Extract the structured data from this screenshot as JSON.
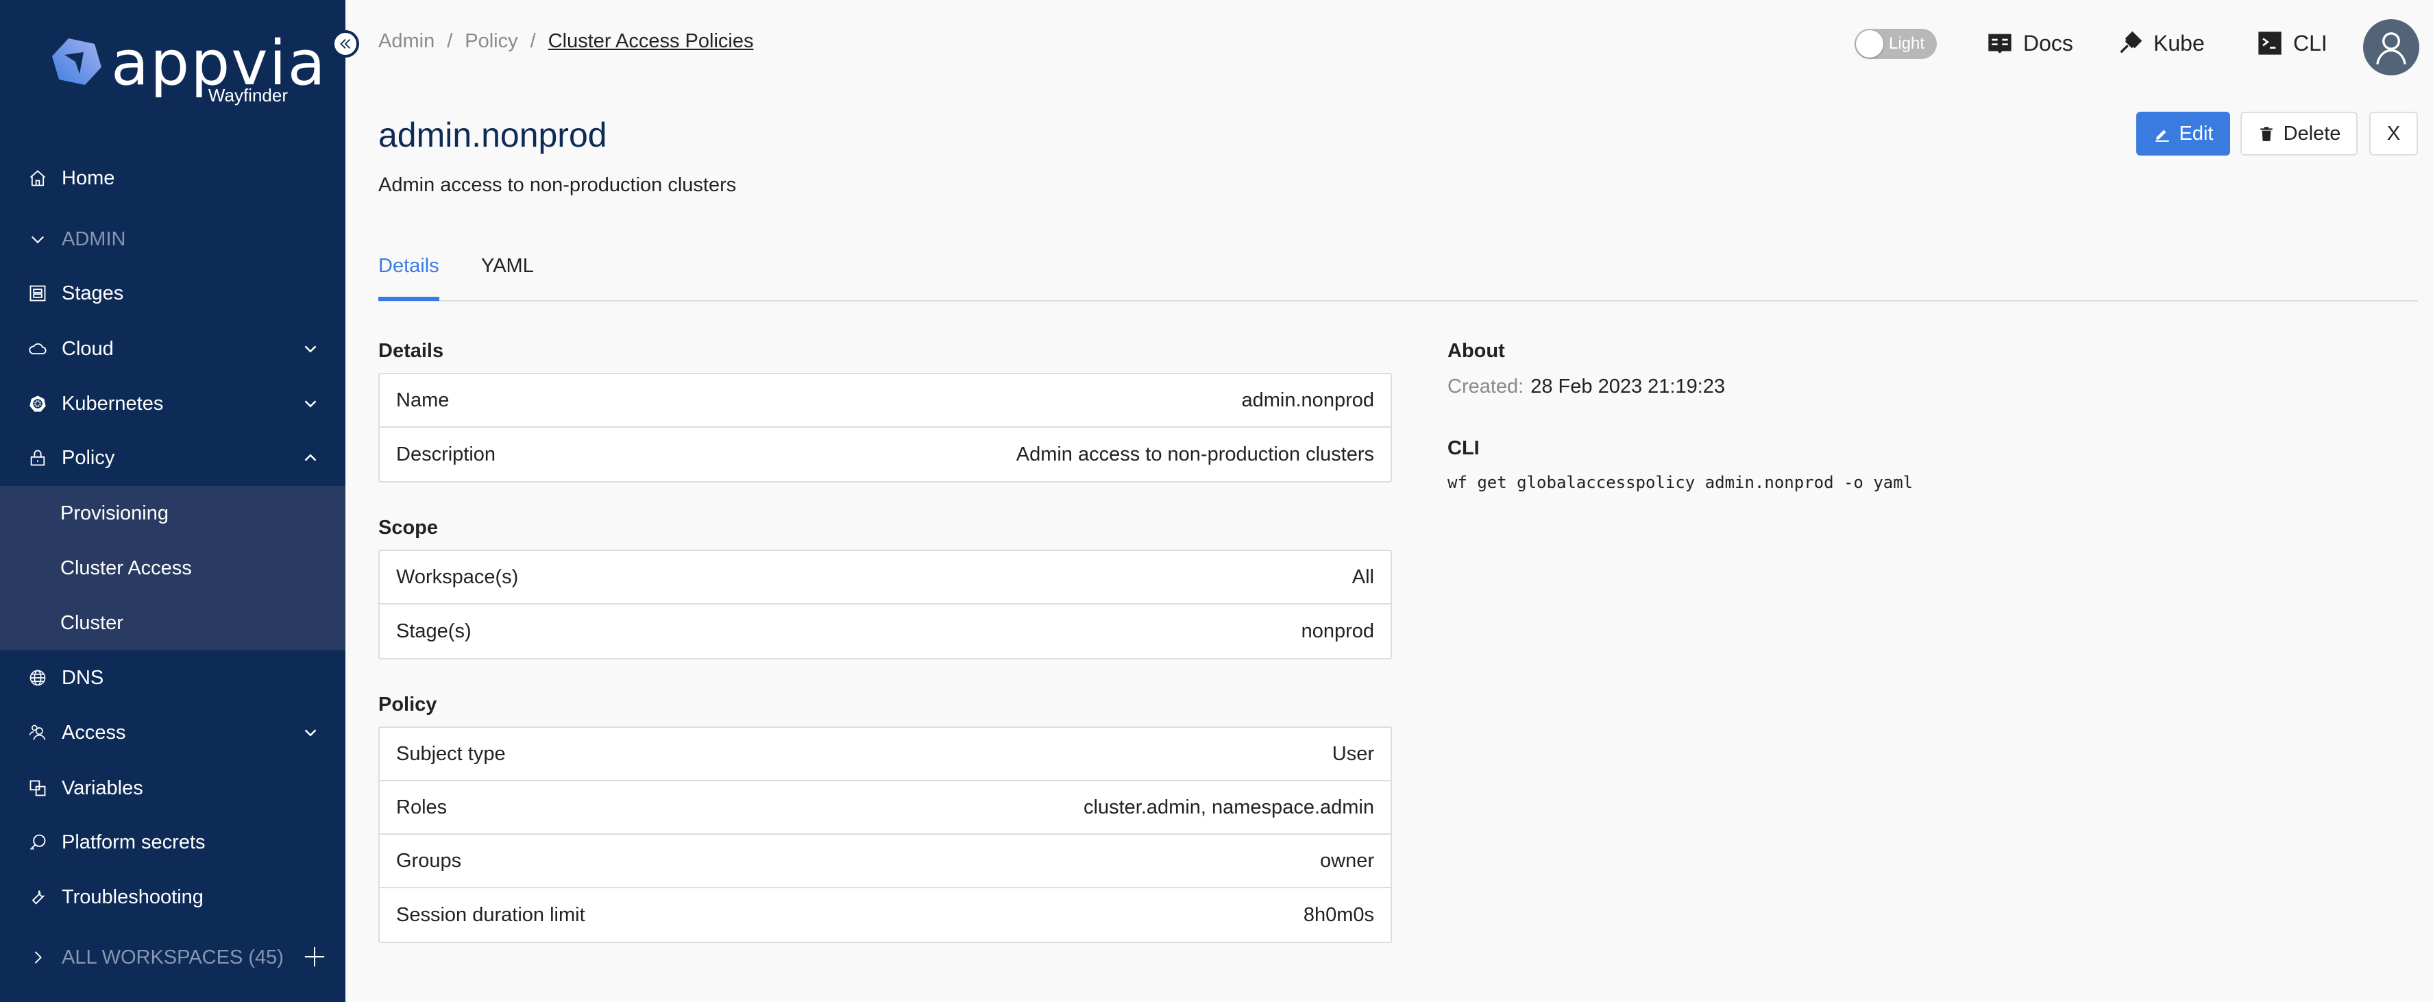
{
  "app": {
    "brand": "appvia",
    "product": "Wayfinder"
  },
  "sidebar": {
    "items": [
      {
        "label": "Home",
        "icon": "home-icon"
      },
      {
        "label": "ADMIN",
        "icon": "chevron-down-icon"
      },
      {
        "label": "Stages",
        "icon": "stages-icon"
      },
      {
        "label": "Cloud",
        "icon": "cloud-icon"
      },
      {
        "label": "Kubernetes",
        "icon": "kubernetes-icon"
      },
      {
        "label": "Policy",
        "icon": "lock-icon"
      },
      {
        "label": "DNS",
        "icon": "globe-icon"
      },
      {
        "label": "Access",
        "icon": "users-icon"
      },
      {
        "label": "Variables",
        "icon": "variables-icon"
      },
      {
        "label": "Platform secrets",
        "icon": "key-icon"
      },
      {
        "label": "Troubleshooting",
        "icon": "wrench-icon"
      }
    ],
    "policy_submenu": [
      "Provisioning",
      "Cluster Access",
      "Cluster"
    ],
    "workspaces_label": "ALL WORKSPACES (45)"
  },
  "breadcrumb": {
    "items": [
      "Admin",
      "Policy"
    ],
    "current": "Cluster Access Policies",
    "separator": "/"
  },
  "topbar": {
    "theme_toggle_label": "Light",
    "docs": "Docs",
    "kube": "Kube",
    "cli": "CLI"
  },
  "page": {
    "title": "admin.nonprod",
    "subtitle": "Admin access to non-production clusters",
    "edit_label": "Edit",
    "delete_label": "Delete",
    "close_label": "X"
  },
  "tabs": [
    {
      "label": "Details",
      "active": true
    },
    {
      "label": "YAML",
      "active": false
    }
  ],
  "details": {
    "heading": "Details",
    "rows": [
      {
        "key": "Name",
        "value": "admin.nonprod"
      },
      {
        "key": "Description",
        "value": "Admin access to non-production clusters"
      }
    ]
  },
  "scope": {
    "heading": "Scope",
    "rows": [
      {
        "key": "Workspace(s)",
        "value": "All"
      },
      {
        "key": "Stage(s)",
        "value": "nonprod"
      }
    ]
  },
  "policy": {
    "heading": "Policy",
    "rows": [
      {
        "key": "Subject type",
        "value": "User"
      },
      {
        "key": "Roles",
        "value": "cluster.admin, namespace.admin"
      },
      {
        "key": "Groups",
        "value": "owner"
      },
      {
        "key": "Session duration limit",
        "value": "8h0m0s"
      }
    ]
  },
  "about": {
    "heading": "About",
    "created_label": "Created:",
    "created_value": "28 Feb 2023 21:19:23"
  },
  "cli": {
    "heading": "CLI",
    "command": "wf get globalaccesspolicy admin.nonprod -o yaml"
  },
  "colors": {
    "sidebar": "#0e2a56",
    "submenu": "#293b62",
    "accent": "#3a7be0",
    "background": "#f9f9f9"
  }
}
